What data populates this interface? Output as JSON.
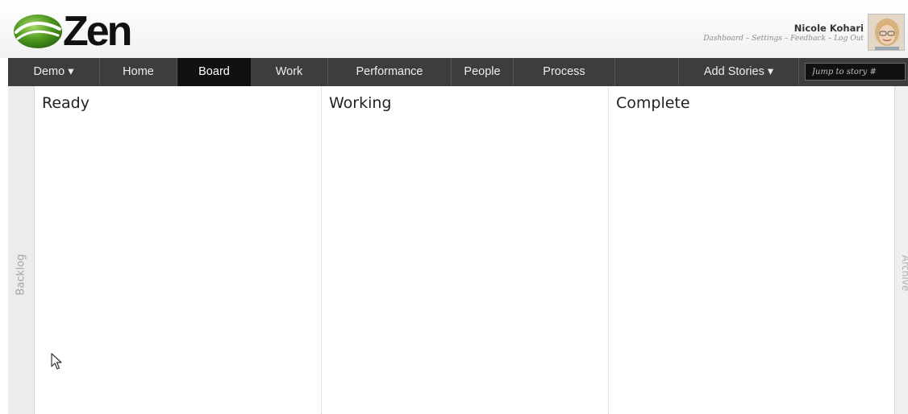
{
  "header": {
    "logo_text": "Zen",
    "user_name": "Nicole Kohari",
    "links": [
      "Dashboard",
      "Settings",
      "Feedback",
      "Log Out"
    ],
    "link_separator": "–"
  },
  "nav": {
    "items": [
      {
        "label": "Demo ▾",
        "active": false
      },
      {
        "label": "Home",
        "active": false
      },
      {
        "label": "Board",
        "active": true
      },
      {
        "label": "Work",
        "active": false
      },
      {
        "label": "Performance",
        "active": false
      },
      {
        "label": "People",
        "active": false
      },
      {
        "label": "Process",
        "active": false
      }
    ],
    "add_stories": "Add Stories ▾",
    "jump_placeholder": "Jump to story #"
  },
  "board": {
    "backlog_label": "Backlog",
    "archive_label": "Archive",
    "columns": [
      {
        "title": "Ready"
      },
      {
        "title": "Working"
      },
      {
        "title": "Complete"
      }
    ]
  },
  "colors": {
    "nav_bg": "#3d3d3d",
    "nav_active_bg": "#111111",
    "logo_green": "#4a8a1e",
    "side_tab_bg": "#ececec"
  }
}
